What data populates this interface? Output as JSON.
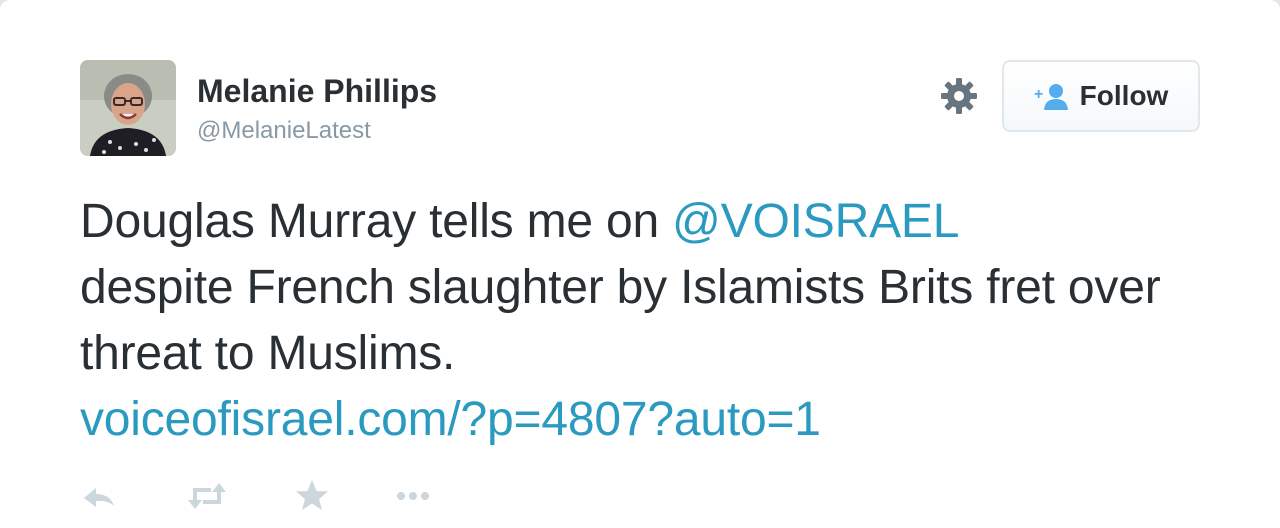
{
  "tweet": {
    "display_name": "Melanie Phillips",
    "screen_name": "@MelanieLatest",
    "text_before_mention": "Douglas Murray tells me on ",
    "mention": "@VOISRAEL",
    "text_after_mention": "despite French slaughter by Islamists Brits fret over threat to Muslims.",
    "link": "voiceofisrael.com/?p=4807?auto=1"
  },
  "header": {
    "follow_label": "Follow",
    "settings_icon": "gear-icon",
    "follow_icon": "add-person-icon"
  },
  "actions": {
    "icons": [
      "reply-icon",
      "retweet-icon",
      "favorite-icon",
      "more-icon"
    ]
  },
  "colors": {
    "text": "#292f33",
    "muted": "#8899a6",
    "link": "#2b9ac0",
    "action_icon": "#ccd6dd"
  }
}
